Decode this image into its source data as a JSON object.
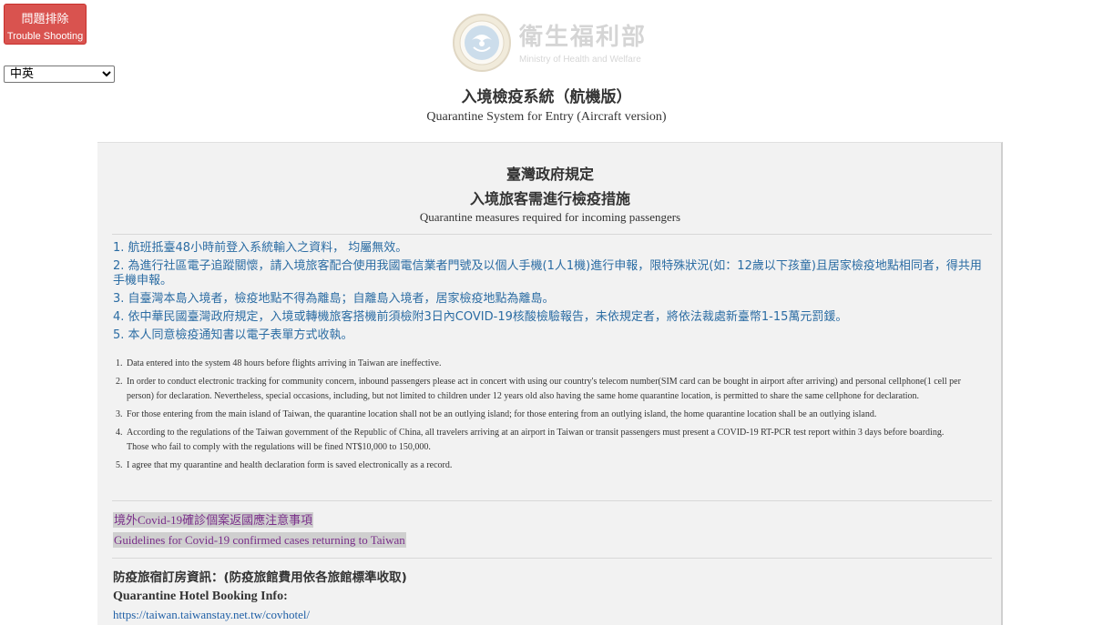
{
  "trouble_button": {
    "label_zh": "問題排除",
    "label_en": "Trouble Shooting"
  },
  "language_select": {
    "selected": "中英",
    "options": [
      "中英"
    ]
  },
  "logo": {
    "name_zh": "衛生福利部",
    "name_en": "Ministry of Health and Welfare"
  },
  "system": {
    "title_zh": "入境檢疫系統（航機版）",
    "title_en": "Quarantine System for Entry (Aircraft version)"
  },
  "notice": {
    "title_line1": "臺灣政府規定",
    "title_line2": "入境旅客需進行檢疫措施",
    "subtitle": "Quarantine measures required for incoming passengers",
    "items_zh": [
      "1. 航班抵臺48小時前登入系統輸入之資料， 均屬無效。",
      "2. 為進行社區電子追蹤關懷，請入境旅客配合使用我國電信業者門號及以個人手機(1人1機)進行申報，限特殊狀況(如：12歲以下孩童)且居家檢疫地點相同者，得共用手機申報。",
      "3. 自臺灣本島入境者，檢疫地點不得為離島；自離島入境者，居家檢疫地點為離島。",
      "4. 依中華民國臺灣政府規定，入境或轉機旅客搭機前須檢附3日內COVID-19核酸檢驗報告，未依規定者，將依法裁處新臺幣1-15萬元罰鍰。",
      "5. 本人同意檢疫通知書以電子表單方式收執。"
    ],
    "items_en": [
      {
        "num": "1.",
        "text": "Data entered into the system 48 hours before flights arriving in Taiwan are ineffective."
      },
      {
        "num": "2.",
        "text": "In order to conduct electronic tracking for community concern, inbound passengers please act in concert with using our country's telecom number(SIM card can be bought in airport after arriving) and personal cellphone(1 cell per person) for declaration. Nevertheless, special occasions, including, but not limited to children under 12 years old also having the same home quarantine location, is permitted to share the same cellphone for declaration."
      },
      {
        "num": "3.",
        "text": "For those entering from the main island of Taiwan, the quarantine location shall not be an outlying island; for those entering from an outlying island, the home quarantine location shall be an outlying island."
      },
      {
        "num": "4.",
        "text": "According to the regulations of the Taiwan government of the Republic of China, all travelers arriving at an airport in Taiwan or transit passengers must present a COVID-19 RT-PCR test report within 3 days before boarding. Those who fail to comply with the regulations will be fined NT$10,000 to 150,000."
      },
      {
        "num": "5.",
        "text": "I agree that my quarantine and health declaration form is saved electronically as a record."
      }
    ]
  },
  "guideline_links": {
    "zh": "境外Covid-19確診個案返國應注意事項",
    "en": "Guidelines for Covid-19 confirmed cases returning to Taiwan"
  },
  "hotel": {
    "title_zh": "防疫旅宿訂房資訊：(防疫旅館費用依各旅館標準收取)",
    "title_en": "Quarantine Hotel Booking Info:",
    "url": "https://taiwan.taiwanstay.net.tw/covhotel/"
  }
}
